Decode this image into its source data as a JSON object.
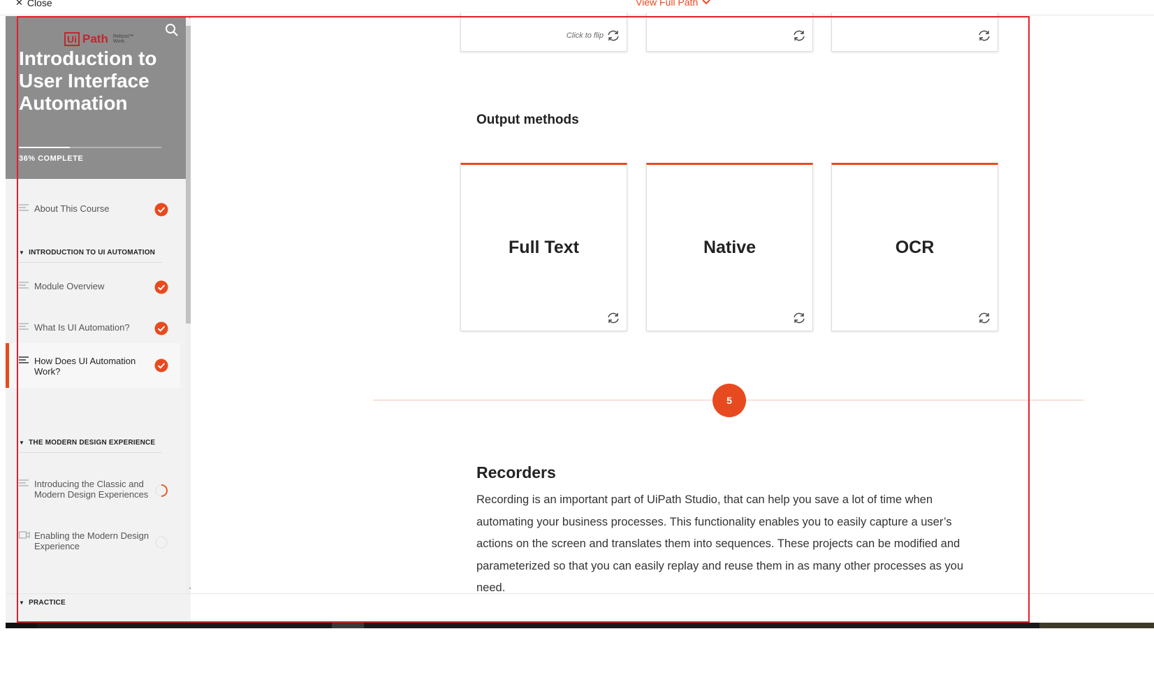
{
  "topbar": {
    "close_label": "Close",
    "view_path_label": "View Full Path"
  },
  "sidebar": {
    "logo_ui": "Ui",
    "logo_path": "Path",
    "logo_tagline_1": "Reboot™",
    "logo_tagline_2": "Work.",
    "course_title": "Introduction to User Interface Automation",
    "progress_label": "36% COMPLETE",
    "progress_value": 0.36,
    "lessons": [
      {
        "label": "About This Course",
        "status": "complete"
      },
      {
        "label": "Module Overview",
        "status": "complete"
      },
      {
        "label": "What Is UI Automation?",
        "status": "complete"
      },
      {
        "label": "How Does UI Automation Work?",
        "status": "complete"
      },
      {
        "label": "Introducing the Classic and Modern Design Experiences",
        "status": "in-progress"
      },
      {
        "label": "Enabling the Modern Design Experience",
        "status": "not-started"
      }
    ],
    "sections": [
      {
        "label": "INTRODUCTION TO UI AUTOMATION"
      },
      {
        "label": "THE MODERN DESIGN EXPERIENCE"
      },
      {
        "label": "PRACTICE"
      }
    ]
  },
  "main": {
    "top_cards": [
      {
        "hint": "Click to flip"
      },
      {
        "hint": ""
      },
      {
        "hint": ""
      }
    ],
    "output_heading": "Output methods",
    "output_cards": [
      {
        "label": "Full Text"
      },
      {
        "label": "Native"
      },
      {
        "label": "OCR"
      }
    ],
    "step_number": "5",
    "recorders_heading": "Recorders",
    "recorders_text": "Recording is an important part of UiPath Studio, that can help you save a lot of time when automating your business processes. This functionality enables you to easily capture a user’s actions on the screen and translates them into sequences. These projects can be modified and parameterized so that you can easily replay and reuse them in as many other processes as you need."
  },
  "colors": {
    "accent": "#e84a1f",
    "sidebar_header": "#8d8d8d",
    "frame": "#e0202a"
  },
  "icons": {
    "complete": "check-circle-icon",
    "in_progress": "progress-ring-icon",
    "not_started": "empty-circle-icon",
    "flip": "flip-icon",
    "search": "search-icon",
    "lesson_text": "text-lines-icon",
    "lesson_video": "video-icon"
  }
}
